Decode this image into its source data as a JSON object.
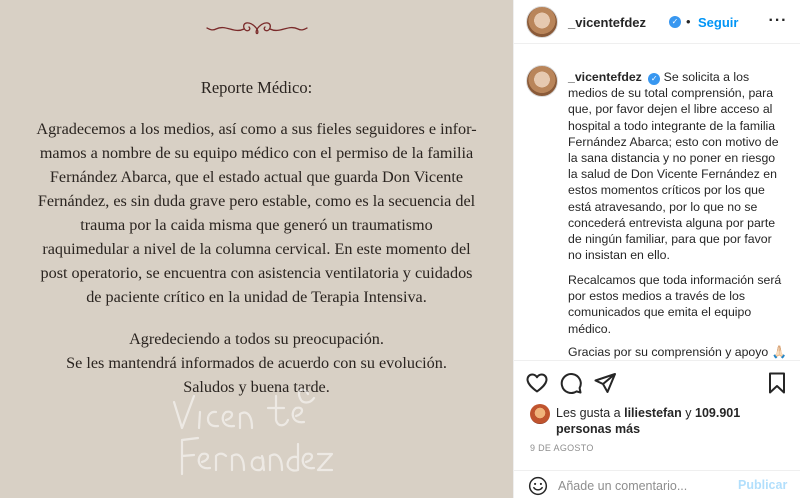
{
  "letter": {
    "heading": "Reporte Médico:",
    "body_lines": [
      "Agradecemos a los medios, así como a sus fieles seguidores e infor-",
      "mamos a nombre de su equipo médico con el permiso de la familia",
      "Fernández Abarca, que el estado actual que guarda Don Vicente",
      "Fernández, es sin duda grave pero estable, como es la secuencia del",
      "trauma por la caida misma que generó un traumatismo",
      "raquimedular a nivel de la columna cervical. En este momento del",
      "post operatorio, se encuentra con asistencia ventilatoria y cuidados",
      "de paciente crítico en la unidad de Terapia Intensiva."
    ],
    "closing_lines": [
      "Agredeciendo a todos su preocupación.",
      "Se les mantendrá informados de acuerdo con su evolución.",
      "Saludos y buena tarde."
    ],
    "signature_line1": "Vicen te",
    "signature_line2": "Fernández"
  },
  "header": {
    "username": "_vicentefdez",
    "follow_label": "Seguir",
    "separator": "•",
    "more_label": "···"
  },
  "caption": {
    "username": "_vicentefdez",
    "paragraph1": "Se solicita a los medios de su total comprensión, para que, por favor dejen el libre acceso al hospital a todo integrante de la familia Fernández Abarca; esto con motivo de la sana distancia y no poner en riesgo la salud de Don Vicente Fernández en estos momentos críticos por los que está atravesando, por lo que no se concederá entrevista alguna por parte de ningún familiar, para que por favor no insistan en ello.",
    "paragraph2": "Recalcamos que toda información será por estos medios a través de los comunicados que emita el equipo médico.",
    "paragraph3": "Gracias por su comprensión y apoyo 🙏🏻"
  },
  "actions": {
    "icons": [
      "heart-icon",
      "comment-icon",
      "share-icon",
      "bookmark-icon"
    ]
  },
  "likes": {
    "prefix": "Les gusta a ",
    "liker": "liliestefan",
    "middle": " y",
    "count": "109.901 personas más"
  },
  "post_date": "9 DE AGOSTO",
  "comment_box": {
    "placeholder": "Añade un comentario...",
    "publish_label": "Publicar"
  },
  "colors": {
    "letter_background": "#d8d0c5",
    "flourish": "#7a2a2a",
    "accent_blue": "#0095f6",
    "publish_disabled": "#b2dffc",
    "verified_badge": "#3897f0"
  }
}
